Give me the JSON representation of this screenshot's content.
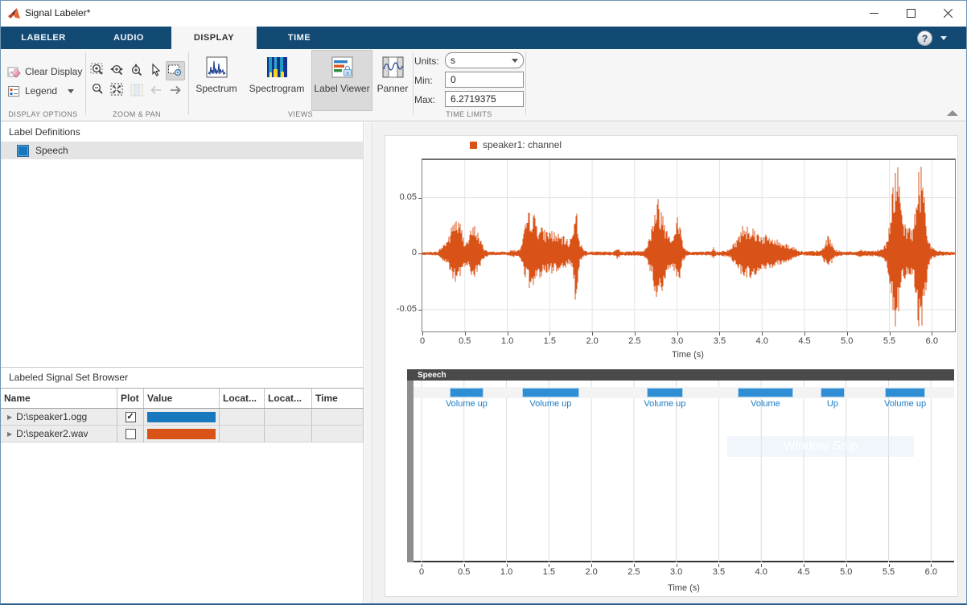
{
  "window": {
    "title": "Signal Labeler*"
  },
  "tabs": [
    {
      "label": "LABELER",
      "active": false
    },
    {
      "label": "AUDIO",
      "active": false
    },
    {
      "label": "DISPLAY",
      "active": true
    },
    {
      "label": "TIME",
      "active": false
    }
  ],
  "help_glyph": "?",
  "toolstrip": {
    "sections": {
      "display_options": {
        "name": "DISPLAY OPTIONS",
        "clear_display_label": "Clear Display",
        "legend_label": "Legend"
      },
      "zoom_pan": {
        "name": "ZOOM & PAN"
      },
      "views": {
        "name": "VIEWS",
        "buttons": [
          {
            "label": "Spectrum",
            "active": false
          },
          {
            "label": "Spectrogram",
            "active": false
          },
          {
            "label": "Label Viewer",
            "active": true
          },
          {
            "label": "Panner",
            "active": false
          }
        ]
      },
      "time_limits": {
        "name": "TIME LIMITS",
        "units_label": "Units:",
        "units_value": "s",
        "min_label": "Min:",
        "min_value": "0",
        "max_label": "Max:",
        "max_value": "6.2719375"
      }
    }
  },
  "label_definitions": {
    "title": "Label Definitions",
    "items": [
      {
        "name": "Speech",
        "color": "#1878be",
        "selected": true
      }
    ]
  },
  "browser": {
    "title": "Labeled Signal Set Browser",
    "columns": [
      "Name",
      "Plot",
      "Value",
      "Locat...",
      "Locat...",
      "Time"
    ],
    "rows": [
      {
        "name": "D:\\speaker1.ogg",
        "plot": true,
        "color": "#1878be"
      },
      {
        "name": "D:\\speaker2.wav",
        "plot": false,
        "color": "#d95319"
      }
    ]
  },
  "watermark": "Window Snip",
  "chart_data": [
    {
      "type": "line",
      "legend": "speaker1: channel",
      "color": "#d95319",
      "xlabel": "Time (s)",
      "xlim": [
        0,
        6.2719375
      ],
      "ylim": [
        -0.0695,
        0.0835
      ],
      "xtick_labels": [
        "0",
        "0.5",
        "1.0",
        "1.5",
        "2.0",
        "2.5",
        "3.0",
        "3.5",
        "4.0",
        "4.5",
        "5.0",
        "5.5",
        "6.0"
      ],
      "ytick_labels": [
        "0.05",
        "0",
        "-0.05"
      ],
      "ytick_values": [
        0.05,
        0,
        -0.05
      ],
      "grid": true,
      "envelope": [
        [
          0,
          0.0015
        ],
        [
          0.18,
          0.002
        ],
        [
          0.22,
          0.006
        ],
        [
          0.28,
          0.012
        ],
        [
          0.33,
          0.02
        ],
        [
          0.37,
          0.035
        ],
        [
          0.41,
          0.032
        ],
        [
          0.45,
          0.028
        ],
        [
          0.49,
          0.014
        ],
        [
          0.53,
          0.012
        ],
        [
          0.58,
          0.024
        ],
        [
          0.63,
          0.027
        ],
        [
          0.68,
          0.014
        ],
        [
          0.73,
          0.005
        ],
        [
          0.78,
          0.002
        ],
        [
          1.0,
          0.002
        ],
        [
          1.08,
          0.004
        ],
        [
          1.13,
          0.003
        ],
        [
          1.17,
          0.008
        ],
        [
          1.22,
          0.03
        ],
        [
          1.27,
          0.042
        ],
        [
          1.32,
          0.036
        ],
        [
          1.38,
          0.026
        ],
        [
          1.44,
          0.022
        ],
        [
          1.5,
          0.023
        ],
        [
          1.56,
          0.02
        ],
        [
          1.62,
          0.017
        ],
        [
          1.68,
          0.015
        ],
        [
          1.73,
          0.012
        ],
        [
          1.77,
          0.02
        ],
        [
          1.8,
          0.053
        ],
        [
          1.83,
          0.03
        ],
        [
          1.86,
          0.01
        ],
        [
          1.9,
          0.004
        ],
        [
          1.95,
          0.002
        ],
        [
          2.25,
          0.002
        ],
        [
          2.3,
          0.007
        ],
        [
          2.33,
          0.002
        ],
        [
          2.6,
          0.003
        ],
        [
          2.65,
          0.009
        ],
        [
          2.7,
          0.025
        ],
        [
          2.74,
          0.045
        ],
        [
          2.78,
          0.051
        ],
        [
          2.82,
          0.042
        ],
        [
          2.86,
          0.03
        ],
        [
          2.9,
          0.024
        ],
        [
          2.94,
          0.016
        ],
        [
          2.98,
          0.02
        ],
        [
          3.01,
          0.041
        ],
        [
          3.04,
          0.025
        ],
        [
          3.07,
          0.01
        ],
        [
          3.1,
          0.004
        ],
        [
          3.15,
          0.002
        ],
        [
          3.4,
          0.002
        ],
        [
          3.43,
          0.006
        ],
        [
          3.46,
          0.002
        ],
        [
          3.62,
          0.004
        ],
        [
          3.66,
          0.009
        ],
        [
          3.7,
          0.013
        ],
        [
          3.74,
          0.02
        ],
        [
          3.78,
          0.028
        ],
        [
          3.83,
          0.029
        ],
        [
          3.88,
          0.026
        ],
        [
          3.93,
          0.022
        ],
        [
          3.98,
          0.019
        ],
        [
          4.05,
          0.017
        ],
        [
          4.12,
          0.015
        ],
        [
          4.2,
          0.012
        ],
        [
          4.28,
          0.01
        ],
        [
          4.35,
          0.007
        ],
        [
          4.42,
          0.004
        ],
        [
          4.48,
          0.002
        ],
        [
          4.7,
          0.003
        ],
        [
          4.74,
          0.01
        ],
        [
          4.78,
          0.017
        ],
        [
          4.82,
          0.011
        ],
        [
          4.86,
          0.004
        ],
        [
          4.95,
          0.002
        ],
        [
          5.1,
          0.002
        ],
        [
          5.15,
          0.004
        ],
        [
          5.2,
          0.003
        ],
        [
          5.3,
          0.003
        ],
        [
          5.42,
          0.005
        ],
        [
          5.47,
          0.012
        ],
        [
          5.51,
          0.035
        ],
        [
          5.54,
          0.065
        ],
        [
          5.57,
          0.085
        ],
        [
          5.6,
          0.078
        ],
        [
          5.63,
          0.05
        ],
        [
          5.66,
          0.03
        ],
        [
          5.7,
          0.024
        ],
        [
          5.74,
          0.028
        ],
        [
          5.78,
          0.024
        ],
        [
          5.81,
          0.045
        ],
        [
          5.84,
          0.075
        ],
        [
          5.87,
          0.083
        ],
        [
          5.9,
          0.07
        ],
        [
          5.93,
          0.045
        ],
        [
          5.96,
          0.014
        ],
        [
          6.0,
          0.006
        ],
        [
          6.05,
          0.003
        ],
        [
          6.27,
          0.0015
        ]
      ]
    },
    {
      "type": "segments",
      "track": "Speech",
      "xlabel": "Time (s)",
      "xlim": [
        0,
        6.2719375
      ],
      "xtick_labels": [
        "0",
        "0.5",
        "1.0",
        "1.5",
        "2.0",
        "2.5",
        "3.0",
        "3.5",
        "4.0",
        "4.5",
        "5.0",
        "5.5",
        "6.0"
      ],
      "segment_color": "#2f8ed3",
      "label_color": "#1b7cc4",
      "instances": [
        {
          "label": "Volume up",
          "start": 0.33,
          "end": 0.73
        },
        {
          "label": "Volume up",
          "start": 1.18,
          "end": 1.86
        },
        {
          "label": "Volume up",
          "start": 2.65,
          "end": 3.08
        },
        {
          "label": "Volume",
          "start": 3.72,
          "end": 4.38
        },
        {
          "label": "Up",
          "start": 4.7,
          "end": 4.98
        },
        {
          "label": "Volume up",
          "start": 5.46,
          "end": 5.93
        }
      ]
    }
  ]
}
